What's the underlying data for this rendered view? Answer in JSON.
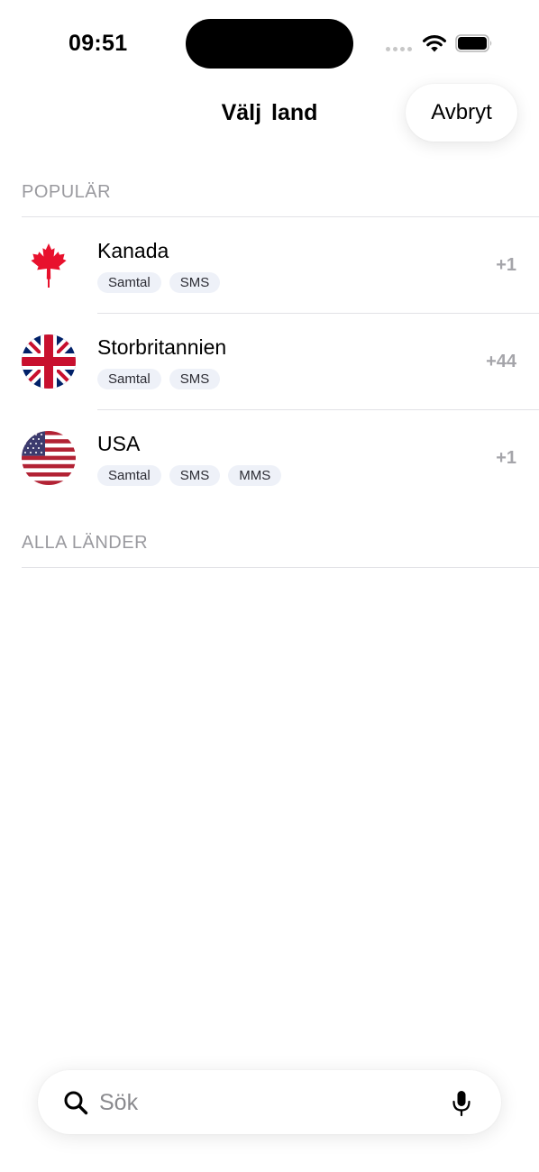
{
  "status_bar": {
    "time": "09:51"
  },
  "nav": {
    "title": "Välj land",
    "cancel_label": "Avbryt"
  },
  "sections": {
    "popular_header": "POPULÄR",
    "all_header": "ALLA LÄNDER"
  },
  "popular": [
    {
      "name": "Kanada",
      "code": "+1",
      "flag": "canada-flag-icon",
      "tags": [
        "Samtal",
        "SMS"
      ]
    },
    {
      "name": "Storbritannien",
      "code": "+44",
      "flag": "uk-flag-icon",
      "tags": [
        "Samtal",
        "SMS"
      ]
    },
    {
      "name": "USA",
      "code": "+1",
      "flag": "usa-flag-icon",
      "tags": [
        "Samtal",
        "SMS",
        "MMS"
      ]
    }
  ],
  "search": {
    "placeholder": "Sök",
    "value": ""
  },
  "colors": {
    "tag_bg": "#eef1f8",
    "secondary_text": "#9a9a9f",
    "code_text": "#a5a5aa",
    "canada_red": "#e8112d",
    "uk_blue": "#012169",
    "uk_red": "#c8102e",
    "us_red": "#b22234",
    "us_blue": "#3c3b6e"
  }
}
